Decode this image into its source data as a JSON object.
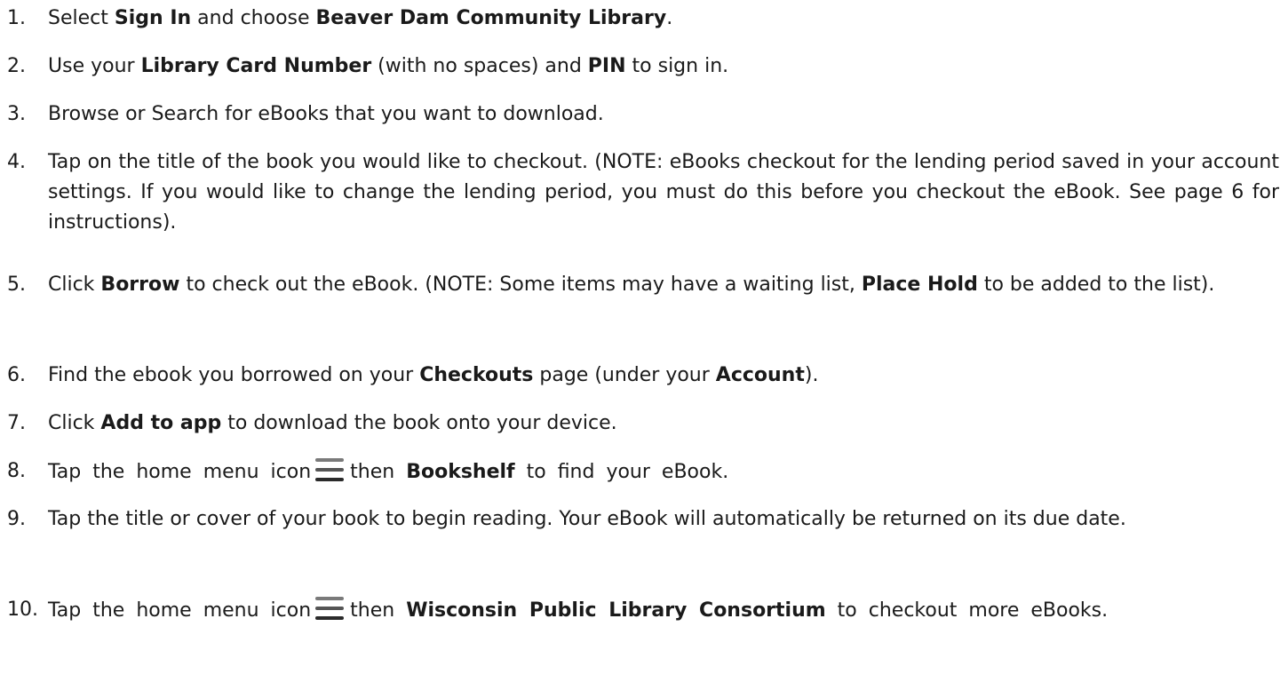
{
  "steps": [
    {
      "number": "1.",
      "parts": [
        {
          "t": "Select "
        },
        {
          "t": "Sign In",
          "b": true
        },
        {
          "t": " and choose "
        },
        {
          "t": "Beaver Dam Community Library",
          "b": true
        },
        {
          "t": "."
        }
      ]
    },
    {
      "number": "2.",
      "parts": [
        {
          "t": "Use your "
        },
        {
          "t": "Library Card Number",
          "b": true
        },
        {
          "t": " (with no spaces) and "
        },
        {
          "t": "PIN",
          "b": true
        },
        {
          "t": " to sign in."
        }
      ]
    },
    {
      "number": "3.",
      "parts": [
        {
          "t": "Browse or Search for eBooks that you want to download."
        }
      ]
    },
    {
      "number": "4.",
      "parts": [
        {
          "t": "Tap on the title of the book you would like to checkout. (NOTE: eBooks checkout for the lending period saved in your account settings. If you would like to change the lending period, you must do this before you checkout the eBook. See page 6 for instructions)."
        }
      ]
    },
    {
      "number": "5.",
      "parts": [
        {
          "t": "Click "
        },
        {
          "t": "Borrow",
          "b": true
        },
        {
          "t": " to check out the eBook. (NOTE: Some items may have a waiting list, "
        },
        {
          "t": "Place Hold",
          "b": true
        },
        {
          "t": " to be added to the list)."
        }
      ]
    },
    {
      "number": "6.",
      "parts": [
        {
          "t": "Find the ebook you borrowed on your "
        },
        {
          "t": "Checkouts",
          "b": true
        },
        {
          "t": " page (under your "
        },
        {
          "t": "Account",
          "b": true
        },
        {
          "t": ")."
        }
      ]
    },
    {
      "number": "7.",
      "parts": [
        {
          "t": "Click "
        },
        {
          "t": "Add to app",
          "b": true
        },
        {
          "t": " to download the book onto your device."
        }
      ]
    },
    {
      "number": "8.",
      "parts": [
        {
          "t": "Tap the home menu icon"
        },
        {
          "icon": "menu-icon"
        },
        {
          "t": "then "
        },
        {
          "t": "Bookshelf",
          "b": true
        },
        {
          "t": " to find your eBook."
        }
      ]
    },
    {
      "number": "9.",
      "parts": [
        {
          "t": "Tap the title or cover of your book to begin reading. Your eBook will automatically be returned on its due date."
        }
      ]
    },
    {
      "number": "10.",
      "parts": [
        {
          "t": "Tap the home menu icon"
        },
        {
          "icon": "menu-icon"
        },
        {
          "t": "then "
        },
        {
          "t": "Wisconsin Public Library Consortium",
          "b": true
        },
        {
          "t": " to checkout more eBooks."
        }
      ]
    }
  ]
}
